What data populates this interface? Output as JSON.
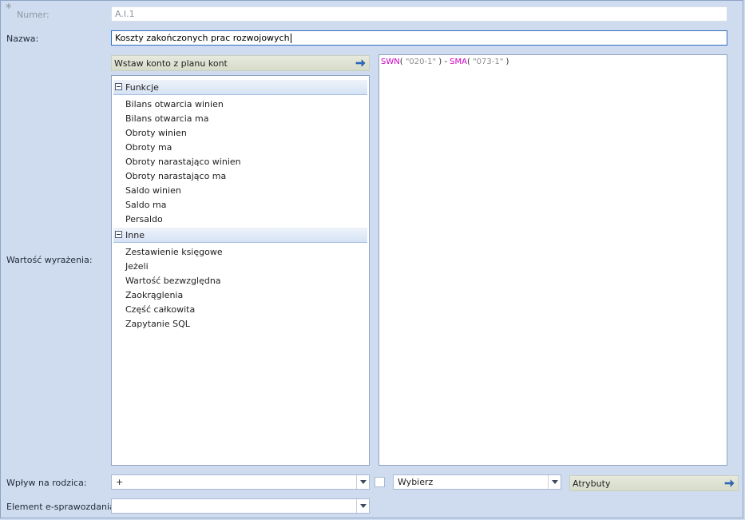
{
  "form": {
    "numer": {
      "label": "Numer:",
      "value": "A.I.1"
    },
    "nazwa": {
      "label": "Nazwa:",
      "value": "Koszty zakończonych prac rozwojowych"
    },
    "wartosc_label": "Wartość wyrażenia:",
    "wplyw": {
      "label": "Wpływ na rodzica:",
      "value": "+"
    },
    "wybierz": {
      "value": "Wybierz"
    },
    "atrybuty_label": "Atrybuty",
    "element": {
      "label": "Element e-sprawozdania",
      "value": ""
    }
  },
  "insert_account_label": "Wstaw konto z planu kont",
  "tree": {
    "groups": [
      {
        "label": "Funkcje",
        "items": [
          "Bilans otwarcia winien",
          "Bilans otwarcia ma",
          "Obroty winien",
          "Obroty ma",
          "Obroty narastająco winien",
          "Obroty narastająco ma",
          "Saldo winien",
          "Saldo ma",
          "Persaldo"
        ]
      },
      {
        "label": "Inne",
        "items": [
          "Zestawienie księgowe",
          "Jeżeli",
          "Wartość bezwzględna",
          "Zaokrąglenia",
          "Część całkowita",
          "Zapytanie SQL"
        ]
      }
    ]
  },
  "expression": {
    "fn1": "SWN",
    "open1": "( ",
    "arg1": "\"020-1\"",
    "close1": " ) - ",
    "fn2": "SMA",
    "open2": "( ",
    "arg2": "\"073-1\"",
    "close2": " )"
  },
  "colors": {
    "function": "#d100c9",
    "string": "#8c8c8c",
    "accent": "#2f6fc4"
  }
}
